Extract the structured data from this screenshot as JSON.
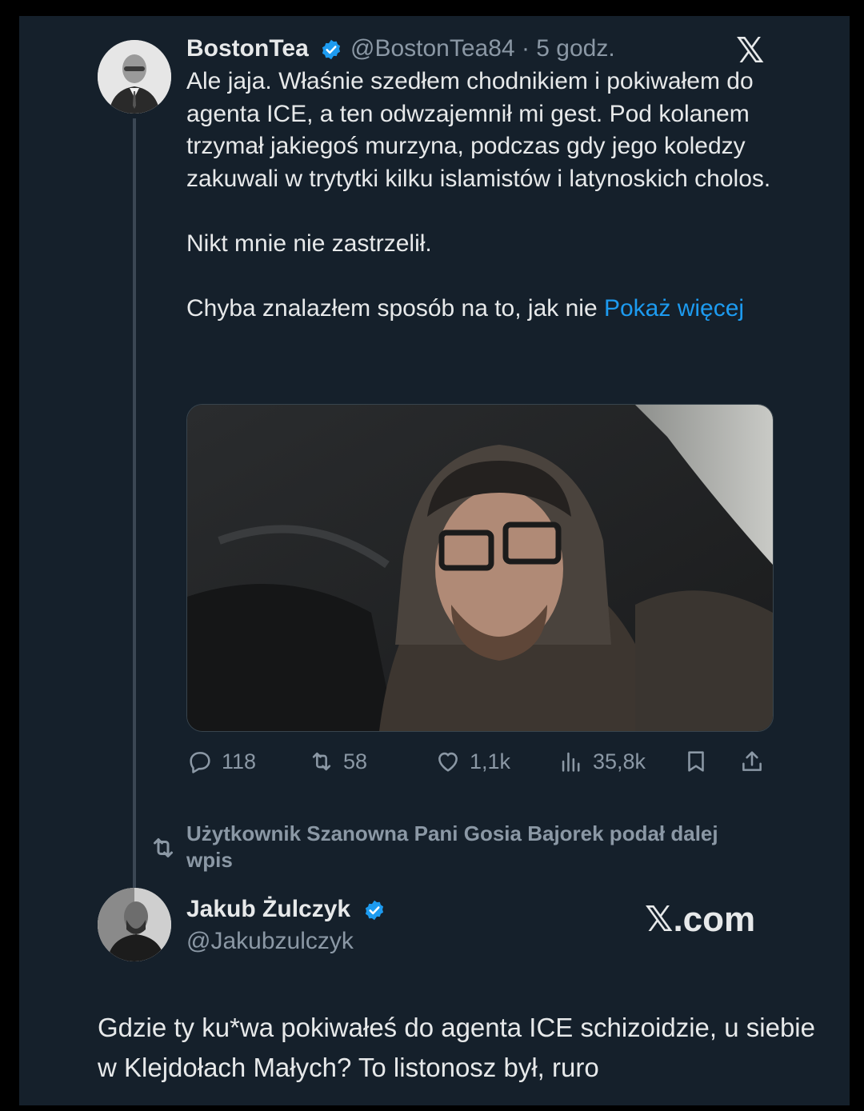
{
  "tweet": {
    "author_name": "BostonTea",
    "handle": "@BostonTea84",
    "separator": "·",
    "time": "5 godz.",
    "platform_mark": "𝕏",
    "paragraphs": [
      "Ale jaja. Właśnie szedłem chodnikiem i pokiwałem do agenta ICE, a ten odwzajemnił mi gest. Pod kolanem trzymał jakiegoś murzyna, podczas gdy jego koledzy zakuwali w trytytki kilku islamistów i latynoskich cholos.",
      "Nikt mnie nie zastrzelił.",
      "Chyba znalazłem sposób na to, jak nie"
    ],
    "show_more": "Pokaż więcej",
    "stats": {
      "replies": "118",
      "reposts": "58",
      "likes": "1,1k",
      "views": "35,8k"
    }
  },
  "repost_notice": "Użytkownik Szanowna Pani Gosia Bajorek podał dalej wpis",
  "reply": {
    "author_name": "Jakub Żulczyk",
    "handle": "@Jakubzulczyk",
    "watermark": "𝕏.com",
    "text": "Gdzie ty ku*wa pokiwałeś do agenta ICE schizoidzie, u siebie w Klejdołach Małych? To listonosz był, ruro"
  },
  "colors": {
    "background": "#15202b",
    "text": "#e7e9ea",
    "muted": "#8b98a5",
    "link": "#1d9bf0",
    "verified": "#1d9bf0"
  },
  "icons": [
    "verified-badge-icon",
    "x-logo-icon",
    "reply-icon",
    "repost-icon",
    "like-icon",
    "views-icon",
    "bookmark-icon",
    "share-icon"
  ]
}
